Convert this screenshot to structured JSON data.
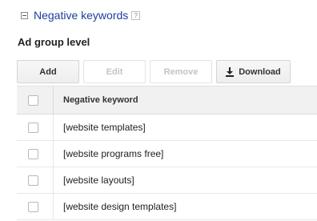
{
  "section": {
    "title": "Negative keywords",
    "help": "?"
  },
  "subheading": "Ad group level",
  "toolbar": {
    "add_label": "Add",
    "edit_label": "Edit",
    "remove_label": "Remove",
    "download_label": "Download"
  },
  "table": {
    "header": "Negative keyword",
    "rows": [
      "[website templates]",
      "[website programs free]",
      "[website layouts]",
      "[website design templates]"
    ]
  }
}
